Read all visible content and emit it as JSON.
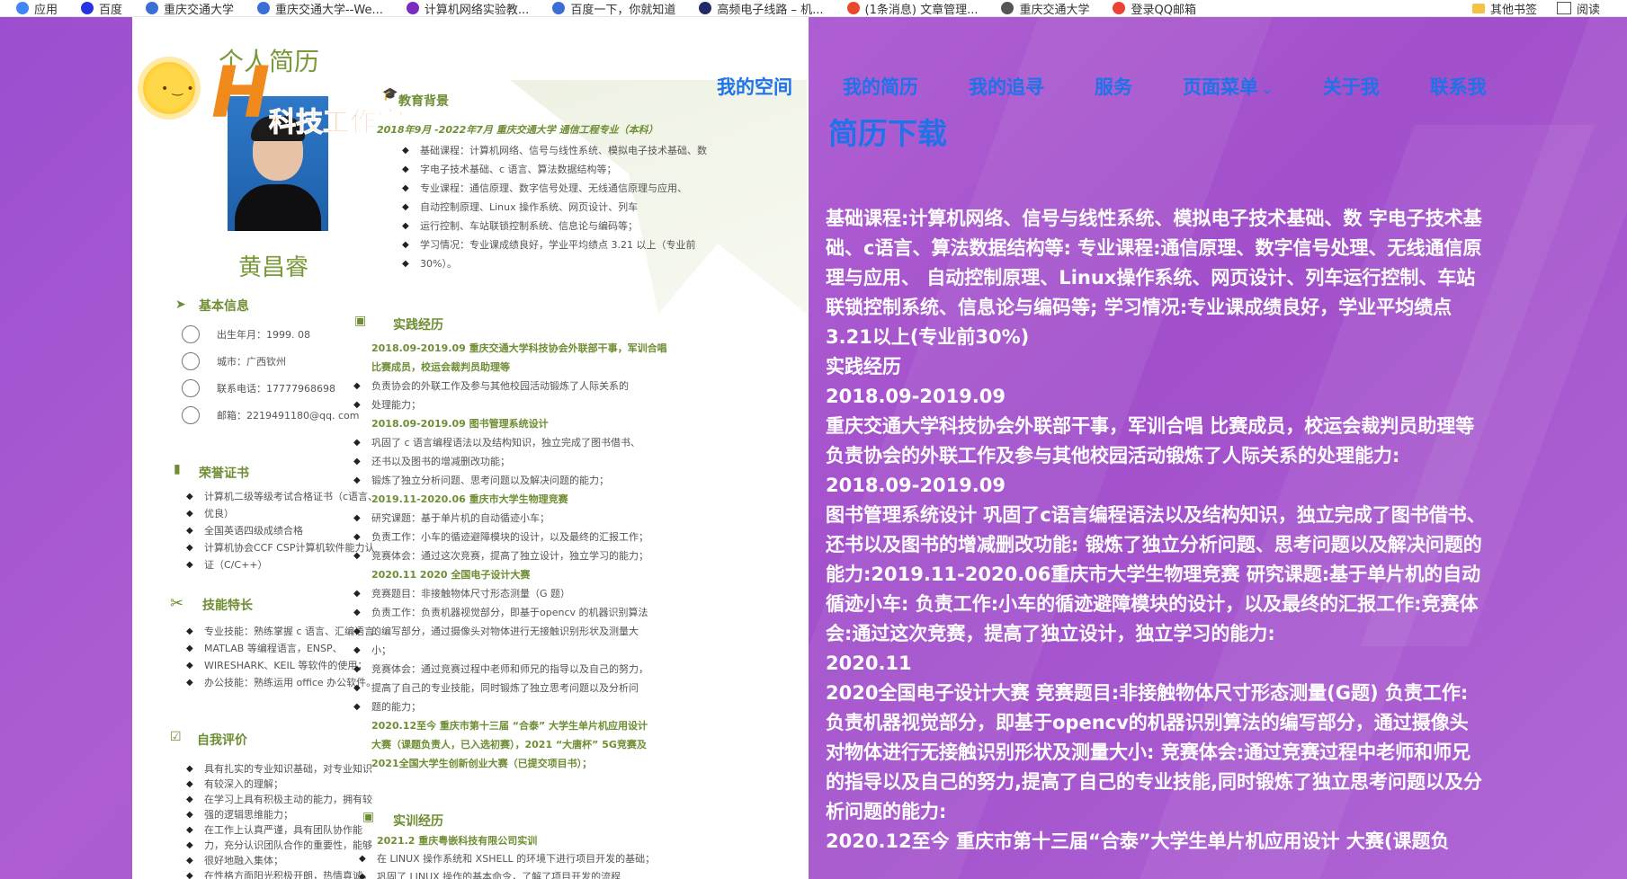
{
  "bookmarks": [
    {
      "label": "应用",
      "icon": "apps-grid-icon",
      "color": "#4285f4"
    },
    {
      "label": "百度",
      "icon": "baidu-paw-icon",
      "color": "#2932e1"
    },
    {
      "label": "重庆交通大学",
      "icon": "globe-icon",
      "color": "#3b6fd6"
    },
    {
      "label": "重庆交通大学--We...",
      "icon": "globe-icon",
      "color": "#3b6fd6"
    },
    {
      "label": "计算机网络实验教...",
      "icon": "w-logo-icon",
      "color": "#7b2cbf"
    },
    {
      "label": "百度一下，你就知道",
      "icon": "globe-icon",
      "color": "#3b6fd6"
    },
    {
      "label": "高频电子线路 – 机...",
      "icon": "dark-globe-icon",
      "color": "#222a6b"
    },
    {
      "label": "(1条消息) 文章管理...",
      "icon": "csdn-c-icon",
      "color": "#e8492b"
    },
    {
      "label": "重庆交通大学",
      "icon": "globe-icon",
      "color": "#555555"
    },
    {
      "label": "登录QQ邮箱",
      "icon": "google-icon",
      "color": "#ea4335"
    }
  ],
  "bookmarks_right": [
    {
      "label": "其他书签",
      "icon": "folder-icon"
    },
    {
      "label": "阅读",
      "icon": "reading-list-icon"
    }
  ],
  "nav": [
    {
      "label": "我的空间"
    },
    {
      "label": "我的简历"
    },
    {
      "label": "我的追寻"
    },
    {
      "label": "服务"
    },
    {
      "label": "页面菜单",
      "caret": "⌄"
    },
    {
      "label": "关于我"
    },
    {
      "label": "联系我"
    }
  ],
  "main": {
    "title": "简历下载",
    "paragraphs": [
      "基础课程:计算机网络、信号与线性系统、模拟电子技术基础、数 字电子技术基础、c语言、算法数据结构等: 专业课程:通信原理、数字信号处理、无线通信原理与应用、 自动控制原理、Linux操作系统、网页设计、列车运行控制、车站联锁控制系统、信息论与编码等; 学习情况:专业课成绩良好，学业平均绩点3.21以上(专业前30%)",
      "实践经历",
      "2018.09-2019.09",
      "重庆交通大学科技协会外联部干事，军训合唱 比赛成员，校运会裁判员助理等 负责协会的外联工作及参与其他校园活动锻炼了人际关系的处理能力:",
      "2018.09-2019.09",
      "图书管理系统设计 巩固了c语言编程语法以及结构知识，独立完成了图书借书、还书以及图书的增减删改功能: 锻炼了独立分析问题、思考问题以及解决问题的能力:2019.11-2020.06重庆市大学生物理竞赛 研究课题:基于单片机的自动循迹小车: 负责工作:小车的循迹避障模块的设计，以及最终的汇报工作:竞赛体会:通过这次竞赛，提高了独立设计，独立学习的能力:",
      "2020.11",
      "2020全国电子设计大赛 竞赛题目:非接触物体尺寸形态测量(G题) 负责工作:负责机器视觉部分，即基于opencv的机器识别算法的编写部分，通过摄像头对物体进行无接触识别形状及测量大小: 竞赛体会:通过竞赛过程中老师和师兄的指导以及自己的努力,提高了自己的专业技能,同时锻炼了独立思考问题以及分析问题的能力:",
      "2020.12至今 重庆市第十三届“合泰”大学生单片机应用设计 大赛(课题负"
    ]
  },
  "resume": {
    "title": "个人简历",
    "logo_letter": "H",
    "logo_text": "科技工作室",
    "name": "黄昌睿",
    "sections": {
      "basic": "基本信息",
      "honors": "荣誉证书",
      "skills": "技能特长",
      "self": "自我评价",
      "edu": "教育背景",
      "practice": "实践经历",
      "training": "实训经历"
    },
    "basic_info": [
      "出生年月：1999. 08",
      "城市：广西钦州",
      "联系电话：17777968698",
      "邮箱：2219491180@qq. com"
    ],
    "honors": [
      "计算机二级等级考试合格证书（c语言、",
      "优良）",
      "全国英语四级成绩合格",
      "计算机协会CCF CSP计算机软件能力认",
      "证（C/C++）"
    ],
    "skills": [
      "专业技能：熟练掌握 c 语言、汇编语言、",
      "MATLAB 等编程语言，ENSP、",
      "WIRESHARK、KEIL 等软件的使用；",
      "办公技能：熟练运用 office 办公软件。"
    ],
    "self_eval": [
      "具有扎实的专业知识基础，对专业知识",
      "有较深入的理解；",
      "在学习上具有积极主动的能力，拥有较",
      "强的逻辑思维能力；",
      "在工作上认真严谨，具有团队协作能",
      "力，充分认识团队合作的重要性，能够",
      "很好地融入集体；",
      "在性格方面阳光积极开朗，热情真诚，"
    ],
    "edu_head": "2018年9月 -2022年7月     重庆交通大学     通信工程专业（本科）",
    "edu_lines": [
      "基础课程：计算机网络、信号与线性系统、模拟电子技术基础、数",
      "字电子技术基础、c 语言、算法数据结构等；",
      "专业课程：通信原理、数字信号处理、无线通信原理与应用、",
      "自动控制原理、Linux 操作系统、网页设计、列车",
      "运行控制、车站联锁控制系统、信息论与编码等；",
      "学习情况：专业课成绩良好，学业平均绩点 3.21 以上（专业前",
      "30%）。"
    ],
    "practice_lines": [
      {
        "t": "2018.09-2019.09        重庆交通大学科技协会外联部干事，军训合唱",
        "s": "gb"
      },
      {
        "t": "比赛成员，校运会裁判员助理等",
        "s": "gb"
      },
      {
        "t": "负责协会的外联工作及参与其他校园活动锻炼了人际关系的",
        "s": ""
      },
      {
        "t": "处理能力；",
        "s": ""
      },
      {
        "t": "2018.09-2019.09          图书管理系统设计",
        "s": "gb"
      },
      {
        "t": "巩固了 c 语言编程语法以及结构知识，独立完成了图书借书、",
        "s": ""
      },
      {
        "t": "还书以及图书的增减删改功能；",
        "s": ""
      },
      {
        "t": "锻炼了独立分析问题、思考问题以及解决问题的能力；",
        "s": ""
      },
      {
        "t": "2019.11-2020.06        重庆市大学生物理竞赛",
        "s": "gb"
      },
      {
        "t": "研究课题：基于单片机的自动循迹小车；",
        "s": ""
      },
      {
        "t": "负责工作：小车的循迹避障模块的设计，以及最终的汇报工作；",
        "s": ""
      },
      {
        "t": "竞赛体会：通过这次竞赛，提高了独立设计，独立学习的能力；",
        "s": ""
      },
      {
        "t": "2020.11                 2020 全国电子设计大赛",
        "s": "gb"
      },
      {
        "t": "竞赛题目：非接触物体尺寸形态测量（G 题）",
        "s": ""
      },
      {
        "t": "负责工作：负责机器视觉部分，即基于opencv 的机器识别算法",
        "s": ""
      },
      {
        "t": "的编写部分，通过摄像头对物体进行无接触识别形状及测量大",
        "s": ""
      },
      {
        "t": "小；",
        "s": ""
      },
      {
        "t": "竞赛体会：通过竞赛过程中老师和师兄的指导以及自己的努力，",
        "s": ""
      },
      {
        "t": "提高了自己的专业技能，同时锻炼了独立思考问题以及分析问",
        "s": ""
      },
      {
        "t": "题的能力；",
        "s": ""
      },
      {
        "t": "2020.12至今         重庆市第十三届 “合泰” 大学生单片机应用设计",
        "s": "gb"
      },
      {
        "t": "大赛（课题负责人，已入选初赛），2021 “大唐杯” 5G竞赛及",
        "s": "gb"
      },
      {
        "t": "2021全国大学生创新创业大赛（已提交项目书）；",
        "s": "gb"
      }
    ],
    "training_lines": [
      {
        "t": "2021.2                 重庆粤嵌科技有限公司实训",
        "s": "gb"
      },
      {
        "t": "在 LINUX 操作系统和 XSHELL 的环境下进行项目开发的基础；",
        "s": ""
      },
      {
        "t": "巩固了 LINUX 操作的基本命令，了解了项目开发的流程",
        "s": ""
      }
    ]
  }
}
